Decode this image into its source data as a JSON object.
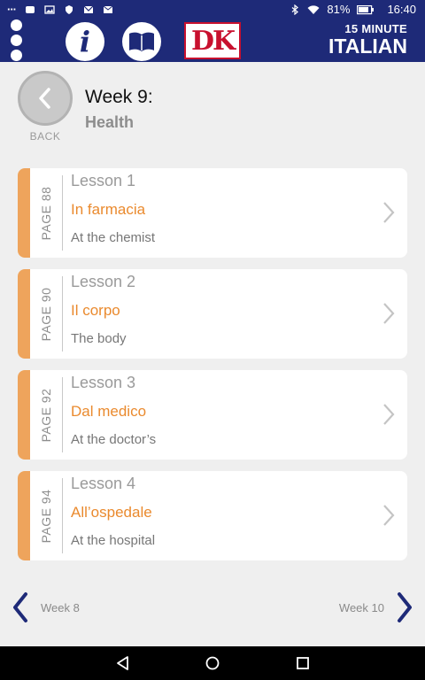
{
  "status_bar": {
    "ellipsis": "···",
    "battery": "81%",
    "time": "16:40"
  },
  "app_bar": {
    "logo_text": "DK",
    "brand_small": "15 MINUTE",
    "brand_big": "ITALIAN"
  },
  "header": {
    "back_label": "BACK",
    "week_title": "Week 9:",
    "week_subtitle": "Health"
  },
  "lessons": [
    {
      "page": "PAGE 88",
      "lesson": "Lesson 1",
      "italian": "In farmacia",
      "english": "At the chemist"
    },
    {
      "page": "PAGE 90",
      "lesson": "Lesson 2",
      "italian": "Il corpo",
      "english": "The body"
    },
    {
      "page": "PAGE 92",
      "lesson": "Lesson 3",
      "italian": "Dal medico",
      "english": "At the doctor’s"
    },
    {
      "page": "PAGE 94",
      "lesson": "Lesson 4",
      "italian": "All’ospedale",
      "english": "At the hospital"
    }
  ],
  "nav": {
    "prev_label": "Week 8",
    "next_label": "Week 10"
  },
  "colors": {
    "primary": "#1e2a78",
    "accent": "#ea8a2e",
    "stripe": "#eea45c"
  }
}
